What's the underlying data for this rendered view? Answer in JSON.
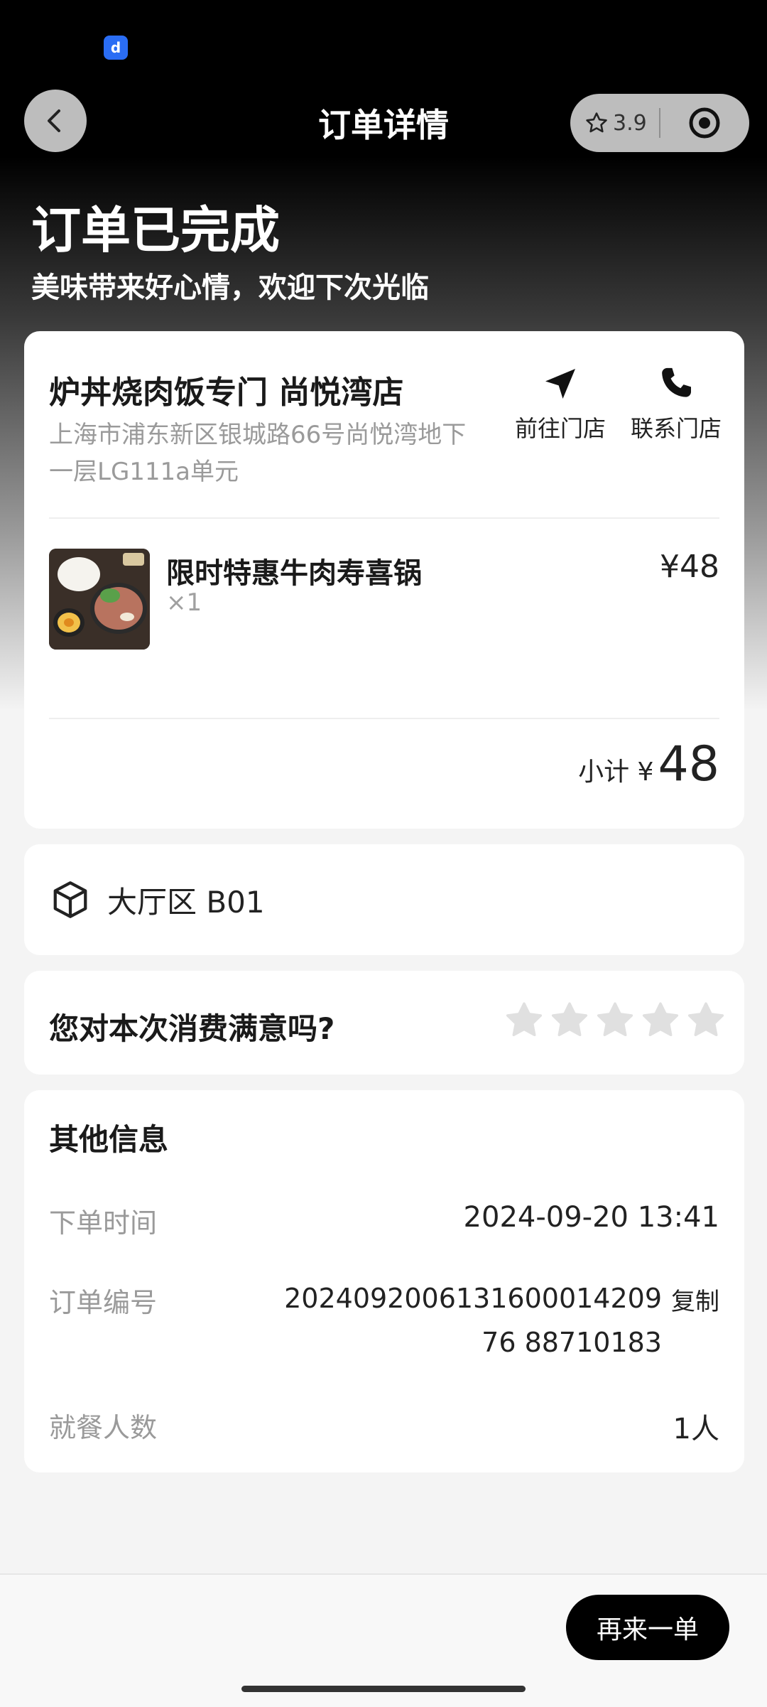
{
  "status_bar": {
    "app_icon": "app-logo-icon"
  },
  "header": {
    "title": "订单详情",
    "rating": "3.9"
  },
  "status": {
    "title": "订单已完成",
    "subtitle": "美味带来好心情，欢迎下次光临"
  },
  "store": {
    "name": "炉丼烧肉饭专门 尚悦湾店",
    "address": "上海市浦东新区银城路66号尚悦湾地下一层LG111a单元",
    "actions": [
      {
        "label": "前往门店",
        "icon": "navigate-icon"
      },
      {
        "label": "联系门店",
        "icon": "phone-icon"
      }
    ]
  },
  "items": [
    {
      "name": "限时特惠牛肉寿喜锅",
      "qty": "×1",
      "price": "¥48"
    }
  ],
  "subtotal": {
    "label": "小计 ¥",
    "amount": "48"
  },
  "table": {
    "label": "大厅区 B01"
  },
  "rating": {
    "question": "您对本次消费满意吗?",
    "stars": 5,
    "selected": 0
  },
  "other_info": {
    "title": "其他信息",
    "order_time": {
      "label": "下单时间",
      "value": "2024-09-20 13:41"
    },
    "order_no": {
      "label": "订单编号",
      "value": "2024092006131600014209​76 88710183",
      "copy_label": "复制"
    },
    "diners": {
      "label": "就餐人数",
      "value": "1人"
    }
  },
  "bottom": {
    "reorder_label": "再来一单"
  },
  "colors": {
    "accent": "#000000",
    "card": "#ffffff",
    "muted": "#9a9a9a",
    "star_empty": "#e0e0e0"
  }
}
